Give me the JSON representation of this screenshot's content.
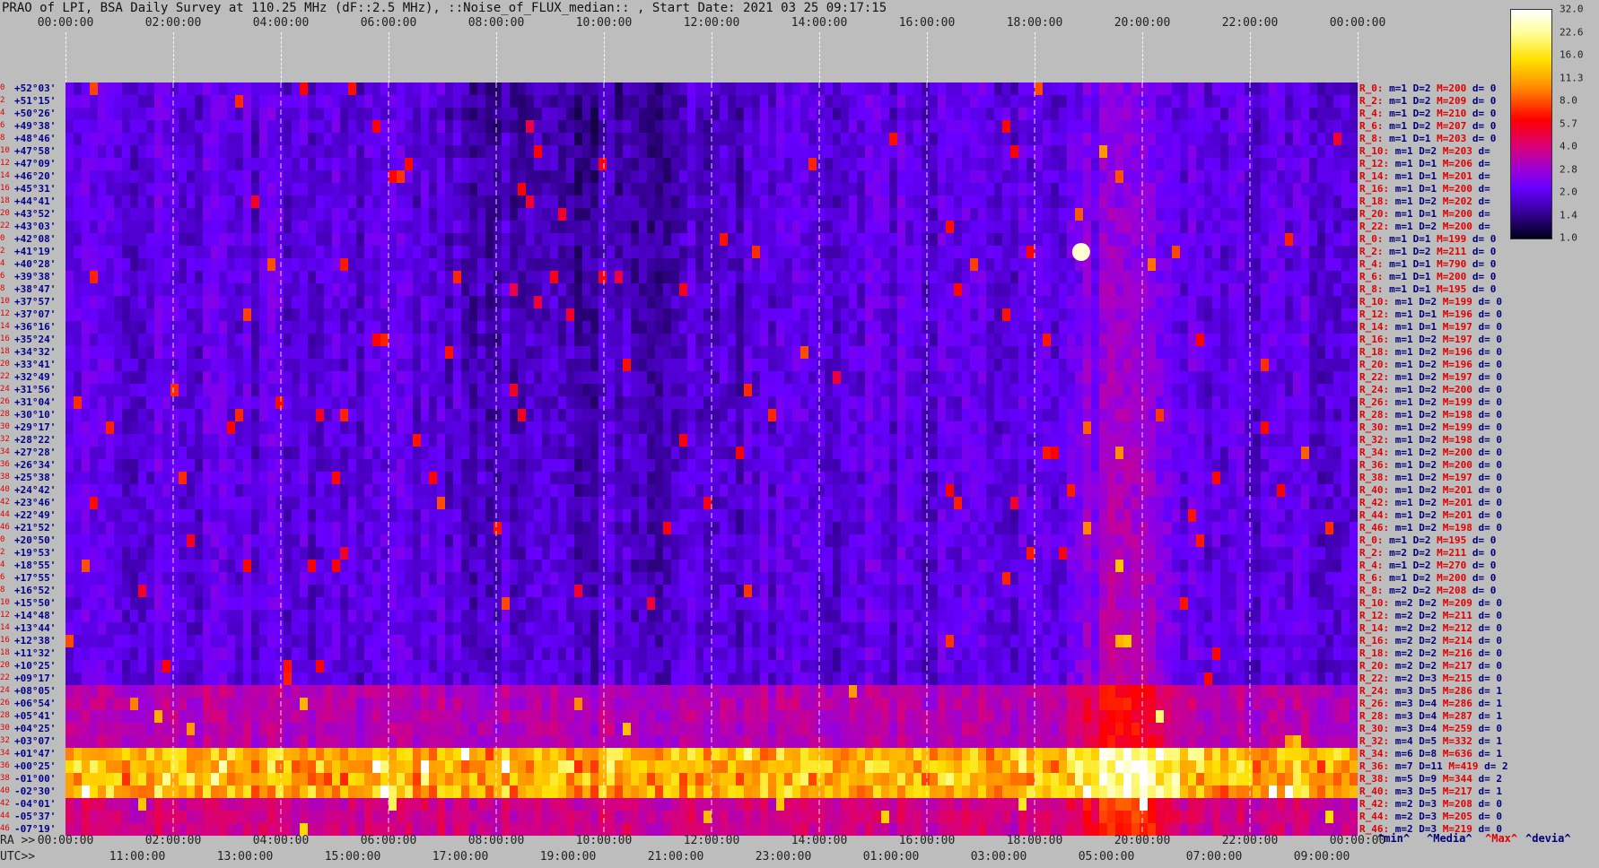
{
  "title": "PRAO of LPI, BSA Daily Survey at 110.25 MHz (dF::2.5 MHz), ::Noise_of_FLUX_median:: , Start Date: 2021 03 25 09:17:15",
  "top_times": [
    "00:00:00",
    "02:00:00",
    "04:00:00",
    "06:00:00",
    "08:00:00",
    "10:00:00",
    "12:00:00",
    "14:00:00",
    "16:00:00",
    "18:00:00",
    "20:00:00",
    "22:00:00",
    "00:00:00"
  ],
  "ra_prefix": "RA >>",
  "ra_times": [
    "00:00:00",
    "02:00:00",
    "04:00:00",
    "06:00:00",
    "08:00:00",
    "10:00:00",
    "12:00:00",
    "14:00:00",
    "16:00:00",
    "18:00:00",
    "20:00:00",
    "22:00:00",
    "00:00:00"
  ],
  "utc_prefix": "UTC>>",
  "utc_times": [
    "11:00:00",
    "13:00:00",
    "15:00:00",
    "17:00:00",
    "19:00:00",
    "21:00:00",
    "23:00:00",
    "01:00:00",
    "03:00:00",
    "05:00:00",
    "07:00:00",
    "09:00:00"
  ],
  "declinations": [
    "+52°03'",
    "+51°15'",
    "+50°26'",
    "+49°38'",
    "+48°46'",
    "+47°58'",
    "+47°09'",
    "+46°20'",
    "+45°31'",
    "+44°41'",
    "+43°52'",
    "+43°03'",
    "+42°08'",
    "+41°19'",
    "+40°28'",
    "+39°38'",
    "+38°47'",
    "+37°57'",
    "+37°07'",
    "+36°16'",
    "+35°24'",
    "+34°32'",
    "+33°41'",
    "+32°49'",
    "+31°56'",
    "+31°04'",
    "+30°10'",
    "+29°17'",
    "+28°22'",
    "+27°28'",
    "+26°34'",
    "+25°38'",
    "+24°42'",
    "+23°46'",
    "+22°49'",
    "+21°52'",
    "+20°50'",
    "+19°53'",
    "+18°55'",
    "+17°55'",
    "+16°52'",
    "+15°50'",
    "+14°48'",
    "+13°44'",
    "+12°38'",
    "+11°32'",
    "+10°25'",
    "+09°17'",
    "+08°05'",
    "+06°54'",
    "+05°41'",
    "+04°25'",
    "+03°07'",
    "+01°47'",
    "+00°25'",
    "-01°00'",
    "-02°30'",
    "-04°01'",
    "-05°37'",
    "-07°19'"
  ],
  "row_index": [
    "0",
    "2",
    "4",
    "6",
    "8",
    "10",
    "12",
    "14",
    "16",
    "18",
    "20",
    "22",
    "0",
    "2",
    "4",
    "6",
    "8",
    "10",
    "12",
    "14",
    "16",
    "18",
    "20",
    "22",
    "24",
    "26",
    "28",
    "30",
    "32",
    "34",
    "36",
    "38",
    "40",
    "42",
    "44",
    "46",
    "0",
    "2",
    "4",
    "6",
    "8",
    "10",
    "12",
    "14",
    "16",
    "18",
    "20",
    "22",
    "24",
    "26",
    "28",
    "30",
    "32",
    "34",
    "36",
    "38",
    "40",
    "42",
    "44",
    "46"
  ],
  "stats": [
    [
      "R_0:",
      "m=1",
      "D=2",
      "M=200",
      "d= 0"
    ],
    [
      "R_2:",
      "m=1",
      "D=2",
      "M=209",
      "d= 0"
    ],
    [
      "R_4:",
      "m=1",
      "D=2",
      "M=210",
      "d= 0"
    ],
    [
      "R_6:",
      "m=1",
      "D=2",
      "M=207",
      "d= 0"
    ],
    [
      "R_8:",
      "m=1",
      "D=1",
      "M=203",
      "d= 0"
    ],
    [
      "R_10:",
      "m=1",
      "D=2",
      "M=203",
      "d="
    ],
    [
      "R_12:",
      "m=1",
      "D=1",
      "M=206",
      "d="
    ],
    [
      "R_14:",
      "m=1",
      "D=1",
      "M=201",
      "d="
    ],
    [
      "R_16:",
      "m=1",
      "D=1",
      "M=200",
      "d="
    ],
    [
      "R_18:",
      "m=1",
      "D=2",
      "M=202",
      "d="
    ],
    [
      "R_20:",
      "m=1",
      "D=1",
      "M=200",
      "d="
    ],
    [
      "R_22:",
      "m=1",
      "D=2",
      "M=200",
      "d="
    ],
    [
      "R_0:",
      "m=1",
      "D=1",
      "M=199",
      "d= 0"
    ],
    [
      "R_2:",
      "m=1",
      "D=2",
      "M=211",
      "d= 0"
    ],
    [
      "R_4:",
      "m=1",
      "D=1",
      "M=790",
      "d= 0"
    ],
    [
      "R_6:",
      "m=1",
      "D=1",
      "M=200",
      "d= 0"
    ],
    [
      "R_8:",
      "m=1",
      "D=1",
      "M=195",
      "d= 0"
    ],
    [
      "R_10:",
      "m=1",
      "D=2",
      "M=199",
      "d= 0"
    ],
    [
      "R_12:",
      "m=1",
      "D=1",
      "M=196",
      "d= 0"
    ],
    [
      "R_14:",
      "m=1",
      "D=1",
      "M=197",
      "d= 0"
    ],
    [
      "R_16:",
      "m=1",
      "D=2",
      "M=197",
      "d= 0"
    ],
    [
      "R_18:",
      "m=1",
      "D=2",
      "M=196",
      "d= 0"
    ],
    [
      "R_20:",
      "m=1",
      "D=2",
      "M=196",
      "d= 0"
    ],
    [
      "R_22:",
      "m=1",
      "D=2",
      "M=197",
      "d= 0"
    ],
    [
      "R_24:",
      "m=1",
      "D=2",
      "M=200",
      "d= 0"
    ],
    [
      "R_26:",
      "m=1",
      "D=2",
      "M=199",
      "d= 0"
    ],
    [
      "R_28:",
      "m=1",
      "D=2",
      "M=198",
      "d= 0"
    ],
    [
      "R_30:",
      "m=1",
      "D=2",
      "M=199",
      "d= 0"
    ],
    [
      "R_32:",
      "m=1",
      "D=2",
      "M=198",
      "d= 0"
    ],
    [
      "R_34:",
      "m=1",
      "D=2",
      "M=200",
      "d= 0"
    ],
    [
      "R_36:",
      "m=1",
      "D=2",
      "M=200",
      "d= 0"
    ],
    [
      "R_38:",
      "m=1",
      "D=2",
      "M=197",
      "d= 0"
    ],
    [
      "R_40:",
      "m=1",
      "D=2",
      "M=201",
      "d= 0"
    ],
    [
      "R_42:",
      "m=1",
      "D=2",
      "M=201",
      "d= 0"
    ],
    [
      "R_44:",
      "m=1",
      "D=2",
      "M=201",
      "d= 0"
    ],
    [
      "R_46:",
      "m=1",
      "D=2",
      "M=198",
      "d= 0"
    ],
    [
      "R_0:",
      "m=1",
      "D=2",
      "M=195",
      "d= 0"
    ],
    [
      "R_2:",
      "m=2",
      "D=2",
      "M=211",
      "d= 0"
    ],
    [
      "R_4:",
      "m=1",
      "D=2",
      "M=270",
      "d= 0"
    ],
    [
      "R_6:",
      "m=1",
      "D=2",
      "M=200",
      "d= 0"
    ],
    [
      "R_8:",
      "m=2",
      "D=2",
      "M=208",
      "d= 0"
    ],
    [
      "R_10:",
      "m=2",
      "D=2",
      "M=209",
      "d= 0"
    ],
    [
      "R_12:",
      "m=2",
      "D=2",
      "M=211",
      "d= 0"
    ],
    [
      "R_14:",
      "m=2",
      "D=2",
      "M=212",
      "d= 0"
    ],
    [
      "R_16:",
      "m=2",
      "D=2",
      "M=214",
      "d= 0"
    ],
    [
      "R_18:",
      "m=2",
      "D=2",
      "M=216",
      "d= 0"
    ],
    [
      "R_20:",
      "m=2",
      "D=2",
      "M=217",
      "d= 0"
    ],
    [
      "R_22:",
      "m=2",
      "D=3",
      "M=215",
      "d= 0"
    ],
    [
      "R_24:",
      "m=3",
      "D=5",
      "M=286",
      "d= 1"
    ],
    [
      "R_26:",
      "m=3",
      "D=4",
      "M=286",
      "d= 1"
    ],
    [
      "R_28:",
      "m=3",
      "D=4",
      "M=287",
      "d= 1"
    ],
    [
      "R_30:",
      "m=3",
      "D=4",
      "M=259",
      "d= 0"
    ],
    [
      "R_32:",
      "m=4",
      "D=5",
      "M=332",
      "d= 1"
    ],
    [
      "R_34:",
      "m=6",
      "D=8",
      "M=636",
      "d= 1"
    ],
    [
      "R_36:",
      "m=7",
      "D=11",
      "M=419",
      "d= 2"
    ],
    [
      "R_38:",
      "m=5",
      "D=9",
      "M=344",
      "d= 2"
    ],
    [
      "R_40:",
      "m=3",
      "D=5",
      "M=217",
      "d= 1"
    ],
    [
      "R_42:",
      "m=2",
      "D=3",
      "M=208",
      "d= 0"
    ],
    [
      "R_44:",
      "m=2",
      "D=3",
      "M=205",
      "d= 0"
    ],
    [
      "R_46:",
      "m=2",
      "D=3",
      "M=219",
      "d= 0"
    ]
  ],
  "colorbar_ticks": [
    "32.0",
    "22.6",
    "16.0",
    "11.3",
    "8.0",
    "5.7",
    "4.0",
    "2.8",
    "2.0",
    "1.4",
    "1.0"
  ],
  "legend": {
    "min": "^min^",
    "median": "^Media^",
    "max": "^Max^",
    "devia": "^devia^"
  },
  "colors": {
    "min": "#00007a",
    "median": "#00007a",
    "max": "#e00000",
    "devia": "#00007a"
  },
  "chart_data": {
    "type": "heatmap",
    "title": "PRAO of LPI, BSA Daily Survey at 110.25 MHz (dF::2.5 MHz), ::Noise_of_FLUX_median:: , Start Date: 2021 03 25 09:17:15",
    "x_ticks_top": [
      "00:00:00",
      "02:00:00",
      "04:00:00",
      "06:00:00",
      "08:00:00",
      "10:00:00",
      "12:00:00",
      "14:00:00",
      "16:00:00",
      "18:00:00",
      "20:00:00",
      "22:00:00",
      "00:00:00"
    ],
    "y_ticks": "declinations",
    "colorbar": [
      32.0,
      22.6,
      16.0,
      11.3,
      8.0,
      5.7,
      4.0,
      2.8,
      2.0,
      1.4,
      1.0
    ],
    "colormap": "black-purple-red-yellow-white"
  }
}
